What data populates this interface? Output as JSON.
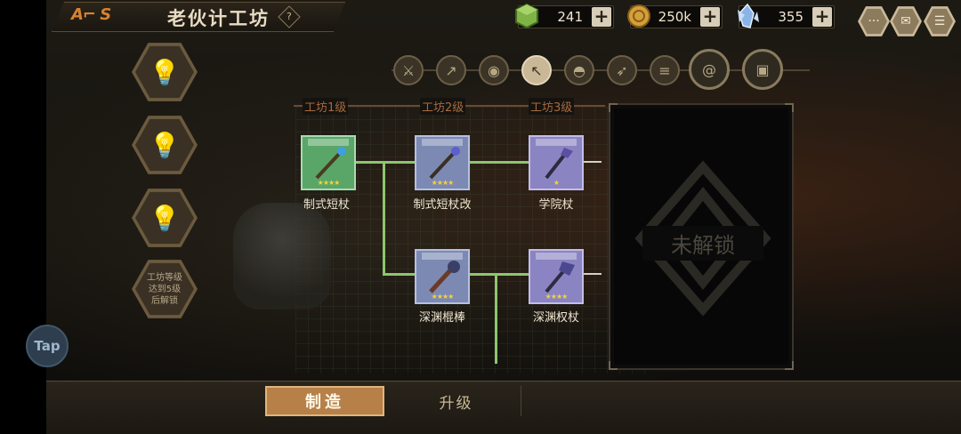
{
  "header": {
    "logo_text": "A⌐ S",
    "title": "老伙计工坊",
    "help_icon": "question-icon"
  },
  "resources": [
    {
      "name": "green-gem",
      "value": "241",
      "icon": "green-cube-icon",
      "color": "#7fb346"
    },
    {
      "name": "coin",
      "value": "250k",
      "icon": "gold-coin-icon",
      "color": "#d4a03b"
    },
    {
      "name": "crystal",
      "value": "355",
      "icon": "blue-crystal-icon",
      "color": "#8ab4e8"
    }
  ],
  "top_buttons": [
    {
      "name": "chat-button",
      "icon": "chat-icon"
    },
    {
      "name": "mail-button",
      "icon": "mail-icon"
    },
    {
      "name": "menu-button",
      "icon": "menu-icon"
    }
  ],
  "left_slots": [
    {
      "icon": "lightbulb-icon"
    },
    {
      "icon": "lightbulb-icon"
    },
    {
      "icon": "lightbulb-icon"
    },
    {
      "lock_text": "工坊等级达到5级后解锁"
    }
  ],
  "category_tabs": [
    {
      "icon": "sword-icon",
      "active": false
    },
    {
      "icon": "spear-icon",
      "active": false
    },
    {
      "icon": "shield-icon",
      "active": false
    },
    {
      "icon": "staff-icon",
      "active": true
    },
    {
      "icon": "helmet-icon",
      "active": false
    },
    {
      "icon": "bow-icon",
      "active": false
    },
    {
      "icon": "scroll-icon",
      "active": false
    },
    {
      "icon": "spiral-icon",
      "active": false
    },
    {
      "icon": "card-icon",
      "active": false
    }
  ],
  "tiers": [
    "工坊1级",
    "工坊2级",
    "工坊3级"
  ],
  "items": [
    {
      "label": "制式短杖",
      "rarity": "green",
      "stars": "★★★★"
    },
    {
      "label": "制式短杖改",
      "rarity": "blue",
      "stars": "★★★★"
    },
    {
      "label": "学院杖",
      "rarity": "purple",
      "stars": "★"
    },
    {
      "label": "深渊棍棒",
      "rarity": "blue",
      "stars": "★★★★"
    },
    {
      "label": "深渊权杖",
      "rarity": "purple",
      "stars": "★★★★"
    }
  ],
  "locked_panel": {
    "text": "未解锁"
  },
  "bottom_tabs": {
    "make": "制造",
    "upgrade": "升级"
  },
  "tap_button": "Tap"
}
